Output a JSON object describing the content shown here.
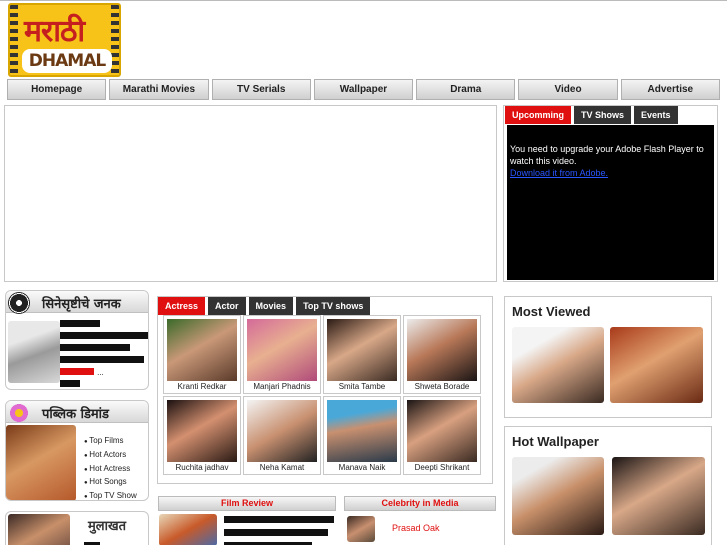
{
  "logo": {
    "line1": "मराठी",
    "line2": "DHAMAL"
  },
  "nav": [
    "Homepage",
    "Marathi Movies",
    "TV Serials",
    "Wallpaper",
    "Drama",
    "Video",
    "Advertise"
  ],
  "media_tabs": [
    "Upcomming",
    "TV Shows",
    "Events"
  ],
  "flash": {
    "message": "You need to upgrade your Adobe Flash Player to watch this video.",
    "link": "Download it from Adobe."
  },
  "left": {
    "block1_title": "सिनेसृष्टीचे जनक",
    "block1_more": "...",
    "block2_title": "पब्लिक डिमांड",
    "block2_links": [
      "Top Films",
      "Hot Actors",
      "Hot Actress",
      "Hot Songs",
      "Top TV Show"
    ],
    "block3_title": "मुलाखत"
  },
  "celeb_tabs": [
    "Actress",
    "Actor",
    "Movies",
    "Top TV shows"
  ],
  "celebs": [
    "Kranti Redkar",
    "Manjari Phadnis",
    "Smita Tambe",
    "Shweta Borade",
    "Ruchita jadhav",
    "Neha Kamat",
    "Manava Naik",
    "Deepti Shrikant"
  ],
  "film_review": "Film Review",
  "celebrity_media": {
    "title": "Celebrity in Media",
    "first": "Prasad Oak"
  },
  "most_viewed": "Most Viewed",
  "hot_wallpaper": "Hot Wallpaper",
  "colors": {
    "accent": "#e01010",
    "tab_dark": "#333333"
  }
}
